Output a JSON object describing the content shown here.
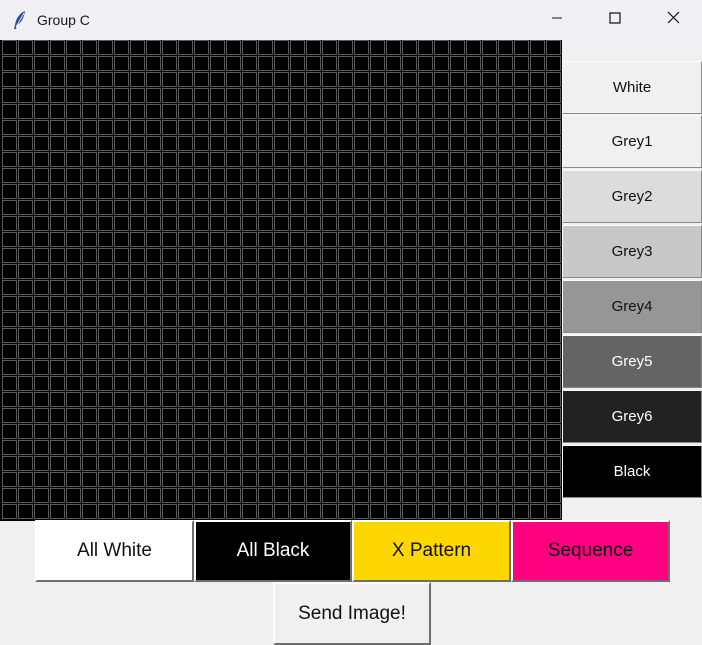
{
  "window": {
    "title": "Group C",
    "app_icon": "feather-icon",
    "controls": {
      "minimize_icon": "minimize-icon",
      "maximize_icon": "maximize-icon",
      "close_icon": "close-icon"
    }
  },
  "pixel_grid": {
    "columns": 35,
    "rows": 30,
    "cell_fill": "#000000",
    "cell_stroke": "#5a5a5a"
  },
  "colors": [
    {
      "label": "White",
      "bg": "#f0f0f0",
      "fg": "#111111"
    },
    {
      "label": "Grey1",
      "bg": "#f0f0f0",
      "fg": "#111111"
    },
    {
      "label": "Grey2",
      "bg": "#dcdcdc",
      "fg": "#111111"
    },
    {
      "label": "Grey3",
      "bg": "#c8c8c8",
      "fg": "#111111"
    },
    {
      "label": "Grey4",
      "bg": "#969696",
      "fg": "#111111"
    },
    {
      "label": "Grey5",
      "bg": "#646464",
      "fg": "#ffffff"
    },
    {
      "label": "Grey6",
      "bg": "#222222",
      "fg": "#ffffff"
    },
    {
      "label": "Black",
      "bg": "#000000",
      "fg": "#ffffff"
    }
  ],
  "patterns": {
    "all_white": {
      "label": "All White",
      "bg": "#ffffff",
      "fg": "#111111"
    },
    "all_black": {
      "label": "All Black",
      "bg": "#000000",
      "fg": "#ffffff"
    },
    "x_pattern": {
      "label": "X Pattern",
      "bg": "#ffd700",
      "fg": "#111111"
    },
    "sequence": {
      "label": "Sequence",
      "bg": "#ff0080",
      "fg": "#111111"
    }
  },
  "send": {
    "label": "Send Image!"
  }
}
